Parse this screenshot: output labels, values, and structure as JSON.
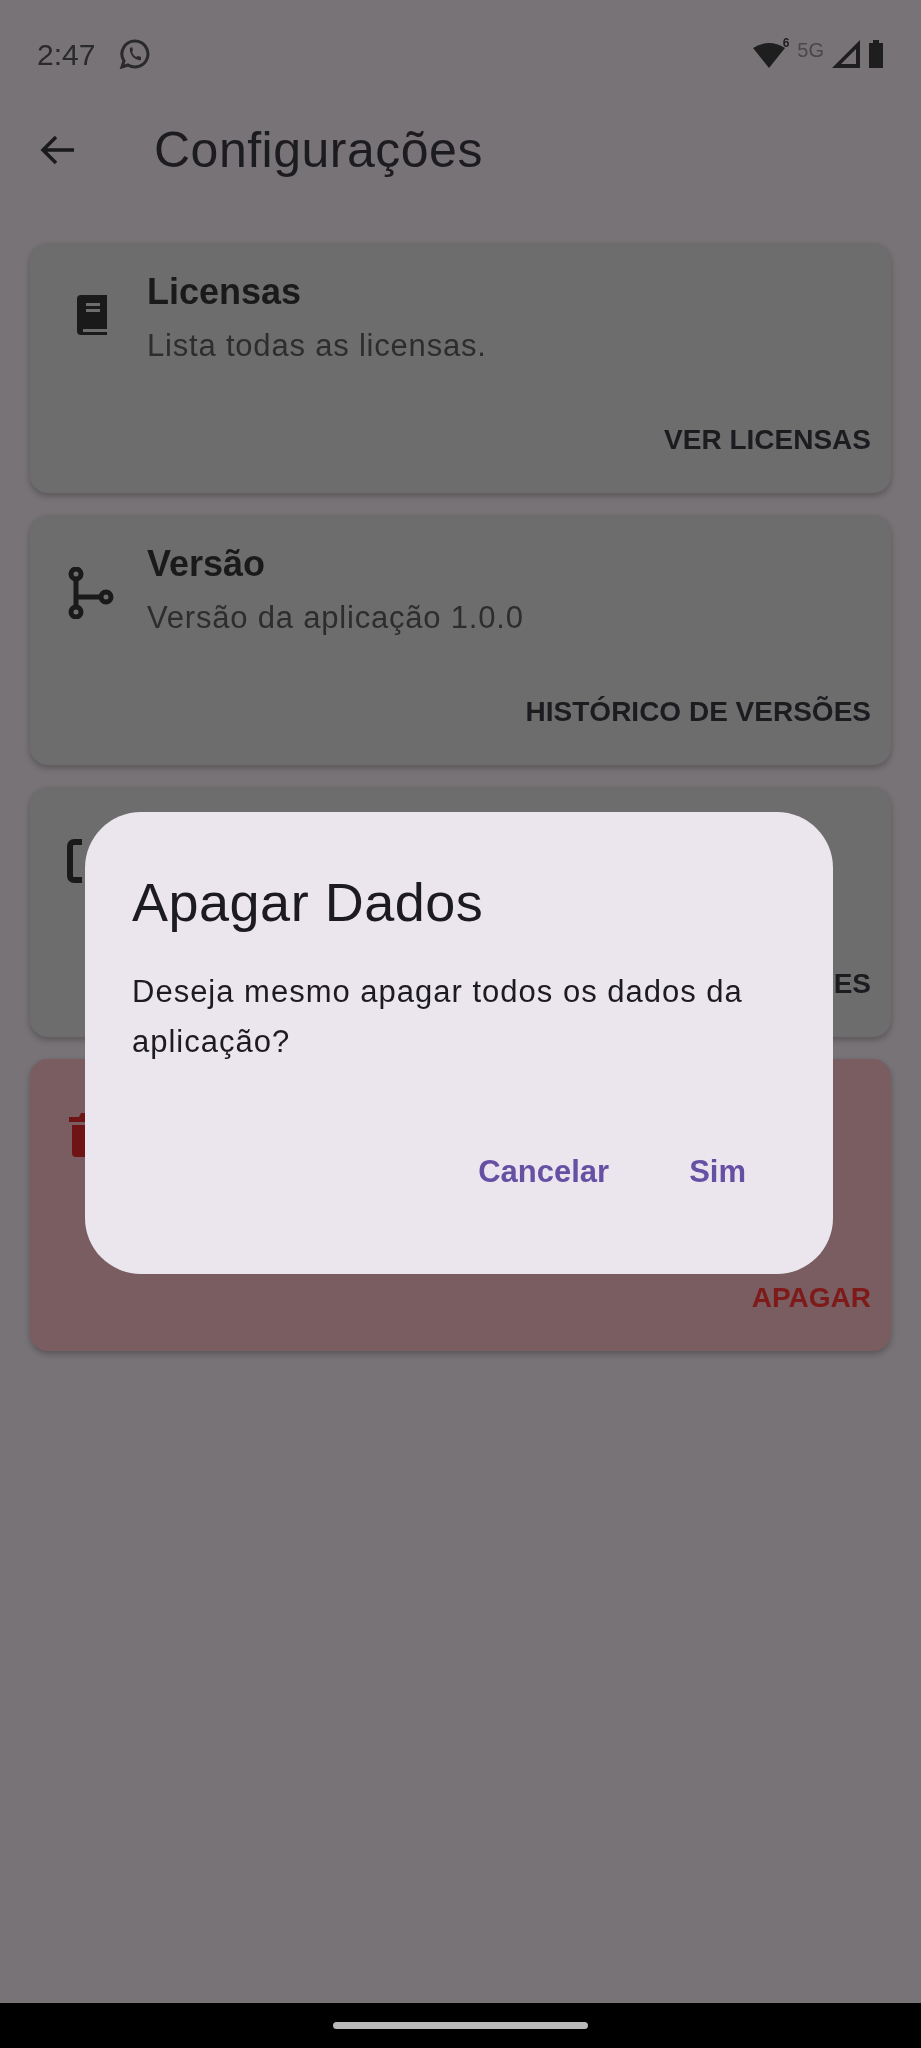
{
  "status_bar": {
    "time": "2:47",
    "wifi_badge": "6",
    "network": "5G"
  },
  "app_bar": {
    "title": "Configurações"
  },
  "cards": [
    {
      "kind": "normal",
      "title": "Licensas",
      "subtitle": "Lista todas as licensas.",
      "button": "VER LICENSAS"
    },
    {
      "kind": "normal",
      "title": "Versão",
      "subtitle": "Versão da aplicação 1.0.0",
      "button": "HISTÓRICO DE VERSÕES"
    },
    {
      "kind": "normal",
      "button": "ES"
    },
    {
      "kind": "danger",
      "button": "APAGAR"
    }
  ],
  "dialog": {
    "title": "Apagar Dados",
    "message": "Deseja mesmo apagar todos os dados da aplicação?",
    "actions": [
      "Cancelar",
      "Sim"
    ]
  }
}
